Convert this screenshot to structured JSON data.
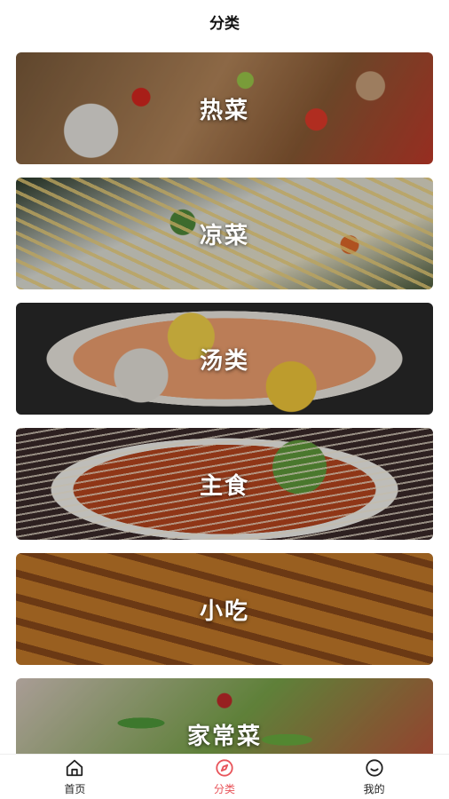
{
  "header": {
    "title": "分类"
  },
  "categories": [
    {
      "label": "热菜"
    },
    {
      "label": "凉菜"
    },
    {
      "label": "汤类"
    },
    {
      "label": "主食"
    },
    {
      "label": "小吃"
    },
    {
      "label": "家常菜"
    }
  ],
  "tabbar": {
    "items": [
      {
        "label": "首页",
        "icon": "home-icon"
      },
      {
        "label": "分类",
        "icon": "compass-icon",
        "active": true
      },
      {
        "label": "我的",
        "icon": "profile-icon"
      }
    ],
    "active_color": "#e8545a",
    "inactive_color": "#222222"
  }
}
